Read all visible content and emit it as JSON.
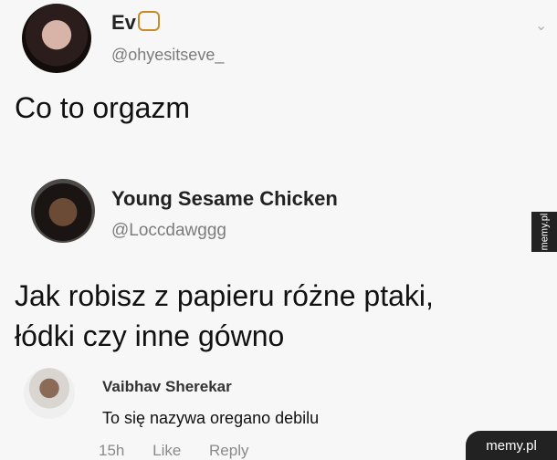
{
  "tweet1": {
    "name": "Ev",
    "handle": "@ohyesitseve_",
    "text": "Co to orgazm"
  },
  "tweet2": {
    "name": "Young Sesame Chicken",
    "handle": "@Loccdawggg",
    "text_line1": "Jak robisz z papieru różne ptaki,",
    "text_line2": "łódki czy inne gówno"
  },
  "comment": {
    "name": "Vaibhav Sherekar",
    "text": "To się nazywa oregano debilu",
    "time": "15h",
    "like_label": "Like",
    "reply_label": "Reply"
  },
  "watermarks": {
    "side": "memy.pl",
    "corner": "memy.pl"
  },
  "icons": {
    "emoji": "lion-face-icon",
    "menu": "chevron-down-icon"
  }
}
